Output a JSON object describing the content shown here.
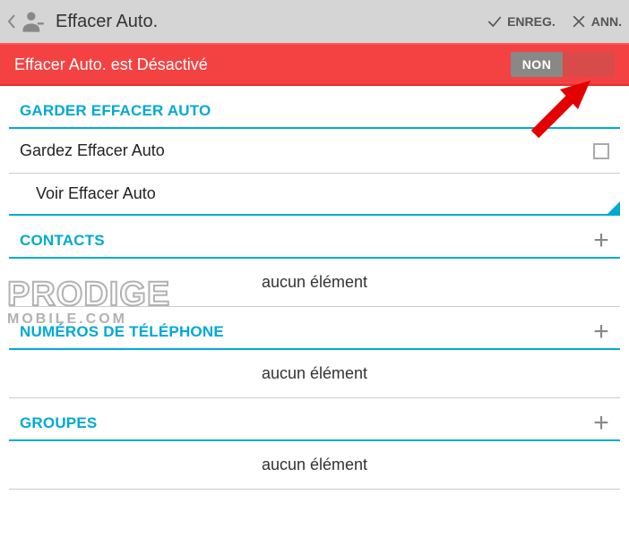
{
  "header": {
    "title": "Effacer Auto.",
    "save_label": "ENREG.",
    "cancel_label": "ANN."
  },
  "status": {
    "text": "Effacer Auto. est Désactivé",
    "toggle_label": "NON"
  },
  "sections": {
    "keep": {
      "title": "GARDER EFFACER AUTO",
      "row_label": "Gardez Effacer Auto",
      "sub_label": "Voir Effacer Auto"
    },
    "contacts": {
      "title": "CONTACTS",
      "empty": "aucun élément"
    },
    "phones": {
      "title": "NUMÉROS DE TÉLÉPHONE",
      "empty": "aucun élément"
    },
    "groups": {
      "title": "GROUPES",
      "empty": "aucun élément"
    }
  },
  "watermark": {
    "line1": "PRODIGE",
    "line2": "MOBILE.COM"
  }
}
